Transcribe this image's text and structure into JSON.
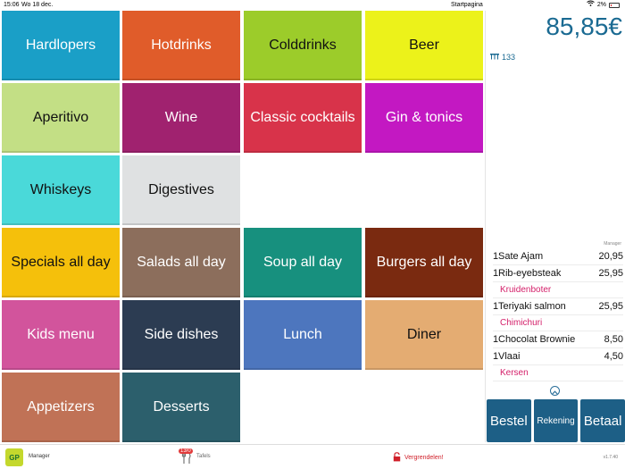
{
  "status": {
    "time": "15:06",
    "date": "Wo 18 dec.",
    "title": "Startpagina",
    "battery": "2%"
  },
  "categories": [
    {
      "label": "Hardlopers",
      "color": "#1a9fc7",
      "text_color": "#ffffff"
    },
    {
      "label": "Hotdrinks",
      "color": "#e05c2a",
      "text_color": "#ffffff"
    },
    {
      "label": "Colddrinks",
      "color": "#9ccc2a",
      "text_color": "#111111"
    },
    {
      "label": "Beer",
      "color": "#ecf21a",
      "text_color": "#111111"
    },
    {
      "label": "Aperitivo",
      "color": "#c3df85",
      "text_color": "#111111"
    },
    {
      "label": "Wine",
      "color": "#a0226f",
      "text_color": "#ffffff"
    },
    {
      "label": "Classic cocktails",
      "color": "#d8334a",
      "text_color": "#ffffff"
    },
    {
      "label": "Gin & tonics",
      "color": "#c318c2",
      "text_color": "#ffffff"
    },
    {
      "label": "Whiskeys",
      "color": "#4ad9d9",
      "text_color": "#111111"
    },
    {
      "label": "Digestives",
      "color": "#dfe1e2",
      "text_color": "#111111"
    },
    {
      "label": "Specials all day",
      "color": "#f5c00b",
      "text_color": "#111111"
    },
    {
      "label": "Salads all day",
      "color": "#8c6e5c",
      "text_color": "#ffffff"
    },
    {
      "label": "Soup all day",
      "color": "#17907e",
      "text_color": "#ffffff"
    },
    {
      "label": "Burgers all day",
      "color": "#7a2a10",
      "text_color": "#ffffff"
    },
    {
      "label": "Kids menu",
      "color": "#d2549c",
      "text_color": "#ffffff"
    },
    {
      "label": "Side dishes",
      "color": "#2c3c52",
      "text_color": "#ffffff"
    },
    {
      "label": "Lunch",
      "color": "#4d76be",
      "text_color": "#ffffff"
    },
    {
      "label": "Diner",
      "color": "#e4ac72",
      "text_color": "#111111"
    },
    {
      "label": "Appetizers",
      "color": "#c07256",
      "text_color": "#ffffff"
    },
    {
      "label": "Desserts",
      "color": "#2c5f6c",
      "text_color": "#ffffff"
    }
  ],
  "panel": {
    "total": "85,85€",
    "table_number": "133",
    "manager_label": "Manager",
    "accent": "#1a6a92"
  },
  "order": [
    {
      "qty": "1",
      "name": "Sate Ajam",
      "price": "20,95",
      "note": ""
    },
    {
      "qty": "1",
      "name": "Rib-eyebsteak",
      "price": "25,95",
      "note": "Kruidenboter"
    },
    {
      "qty": "1",
      "name": "Teriyaki salmon",
      "price": "25,95",
      "note": "Chimichuri"
    },
    {
      "qty": "1",
      "name": "Chocolat Brownie",
      "price": "8,50",
      "note": ""
    },
    {
      "qty": "1",
      "name": "Vlaai",
      "price": "4,50",
      "note": "Kersen"
    }
  ],
  "actions": {
    "order": "Bestel",
    "bill": "Rekening",
    "pay": "Betaal"
  },
  "bottom": {
    "logo_text": "GP",
    "user": "Manager",
    "tables_badge": "13/0",
    "tables_label": "Tafels",
    "lock_label": "Vergrendelen!",
    "version": "v1.7.40"
  }
}
